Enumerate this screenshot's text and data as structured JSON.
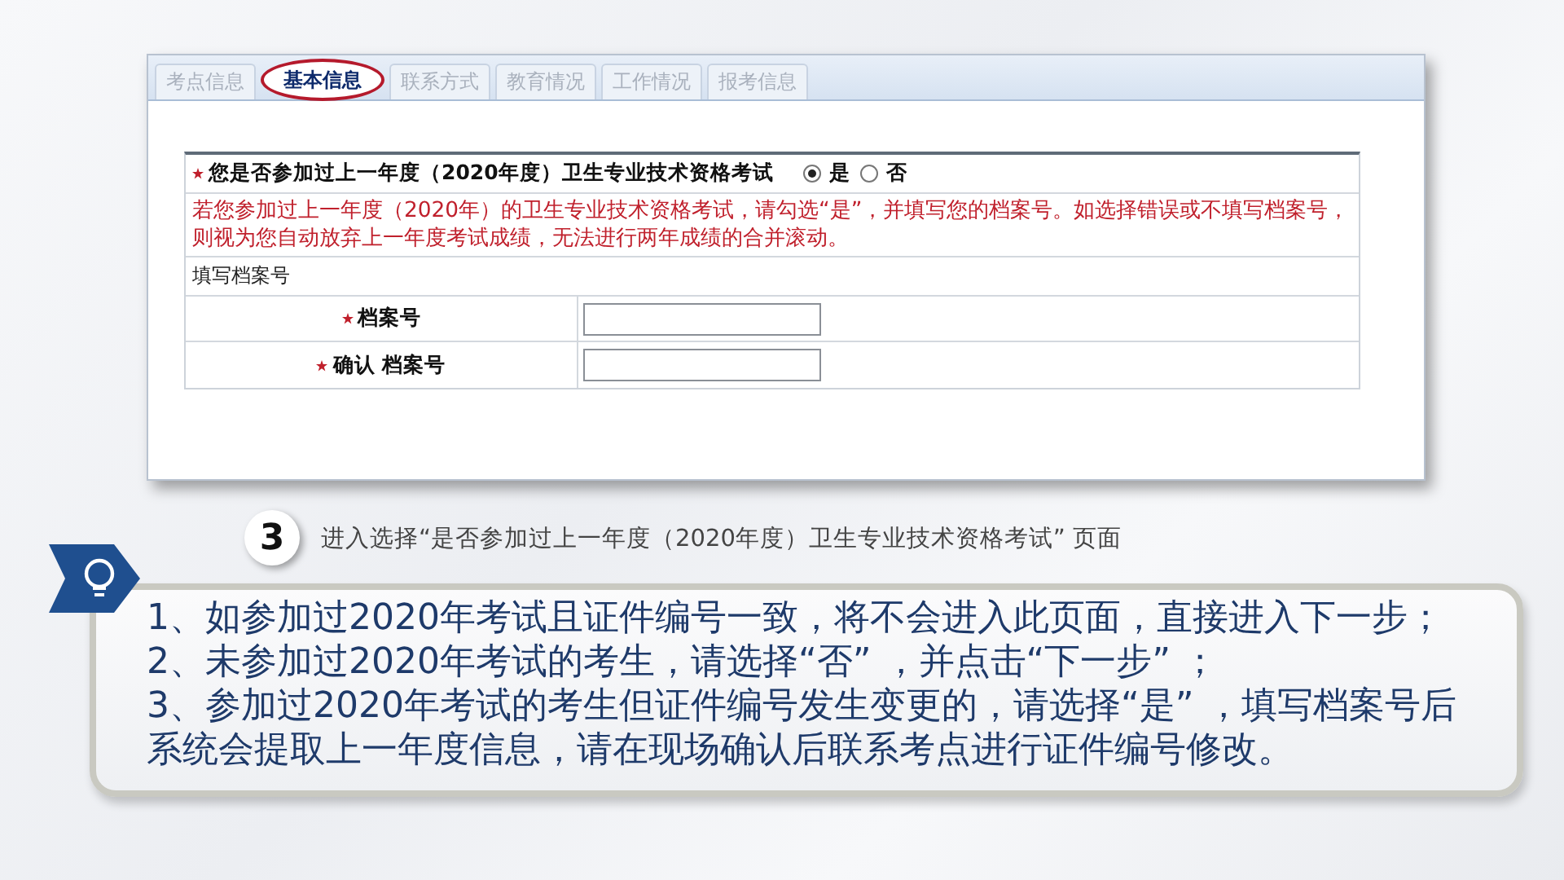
{
  "tabs": [
    {
      "label": "考点信息",
      "selected": false
    },
    {
      "label": "基本信息",
      "selected": true
    },
    {
      "label": "联系方式",
      "selected": false
    },
    {
      "label": "教育情况",
      "selected": false
    },
    {
      "label": "工作情况",
      "selected": false
    },
    {
      "label": "报考信息",
      "selected": false
    }
  ],
  "question": {
    "required": true,
    "text": "您是否参加过上一年度（2020年度）卫生专业技术资格考试",
    "options": [
      {
        "label": "是",
        "selected": true
      },
      {
        "label": "否",
        "selected": false
      }
    ]
  },
  "hint": "若您参加过上一年度（2020年）的卫生专业技术资格考试，请勾选“是”，并填写您的档案号。如选择错误或不填写档案号，则视为您自动放弃上一年度考试成绩，无法进行两年成绩的合并滚动。",
  "section_label": "填写档案号",
  "fields": [
    {
      "label": "档案号",
      "required": true
    },
    {
      "label": "确认 档案号",
      "required": true
    }
  ],
  "step": {
    "number": "3",
    "caption": "进入选择“是否参加过上一年度（2020年度）卫生专业技术资格考试” 页面"
  },
  "notes": [
    "1、如参加过2020年考试且证件编号一致，将不会进入此页面，直接进入下一步；",
    "2、未参加过2020年考试的考生，请选择“否” ，并点击“下一步” ；",
    "3、参加过2020年考试的考生但证件编号发生变更的，请选择“是” ，填写档案号后系统会提取上一年度信息，请在现场确认后联系考点进行证件编号修改。"
  ]
}
